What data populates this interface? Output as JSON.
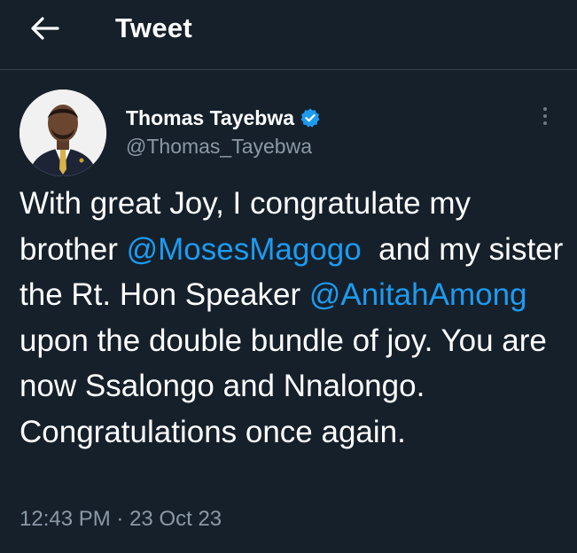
{
  "header": {
    "back_icon": "arrow-left-icon",
    "title": "Tweet"
  },
  "author": {
    "display_name": "Thomas Tayebwa",
    "verified_icon": "verified-badge-icon",
    "handle": "@Thomas_Tayebwa",
    "avatar_icon": "profile-photo"
  },
  "more_icon": "more-vertical-icon",
  "tweet": {
    "segments": [
      {
        "text": "With great Joy, I congratulate my brother ",
        "mention": false
      },
      {
        "text": "@MosesMagogo",
        "mention": true
      },
      {
        "text": "  and my sister the Rt. Hon Speaker ",
        "mention": false
      },
      {
        "text": "@AnitahAmong",
        "mention": true
      },
      {
        "text": " upon the double bundle of joy. You are now Ssalongo and Nnalongo. Congratulations once again.",
        "mention": false
      }
    ]
  },
  "meta": {
    "time": "12:43 PM",
    "separator": "·",
    "date": "23 Oct 23"
  },
  "colors": {
    "background": "#15202b",
    "accent": "#1d9bf0",
    "secondary_text": "#8b98a5",
    "divider": "#38444d"
  }
}
